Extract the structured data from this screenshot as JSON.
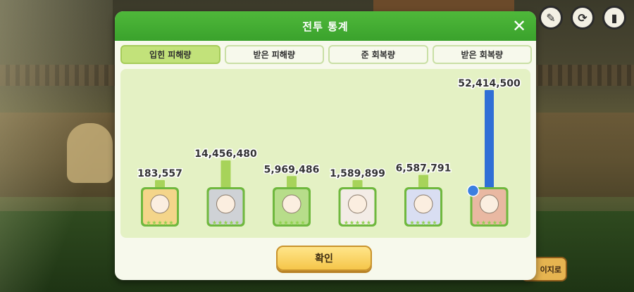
{
  "modal": {
    "title": "전투 통계",
    "close_label": "✕"
  },
  "tabs": [
    {
      "label": "입힌 피해량",
      "active": true
    },
    {
      "label": "받은 피해량",
      "active": false
    },
    {
      "label": "준 회복량",
      "active": false
    },
    {
      "label": "받은 회복량",
      "active": false
    }
  ],
  "confirm_label": "확인",
  "side_tab_label": "이지로",
  "hud": {
    "icons": [
      "pin-icon",
      "swap-icon",
      "stats-icon"
    ]
  },
  "colors": {
    "header_green": "#3aa22c",
    "bar_green": "#a7d35a",
    "bar_blue": "#2f6fd6",
    "panel_bg": "#e4f1c4"
  },
  "chart_data": {
    "type": "bar",
    "title": "",
    "xlabel": "",
    "ylabel": "",
    "categories": [
      "character-1",
      "character-2",
      "character-3",
      "character-4",
      "character-5",
      "character-6"
    ],
    "value_labels": [
      "183,557",
      "14,456,480",
      "5,969,486",
      "1,589,899",
      "6,587,791",
      "52,414,500"
    ],
    "values": [
      183557,
      14456480,
      5969486,
      1589899,
      6587791,
      52414500
    ],
    "highlight_index": 5,
    "ylim": [
      0,
      52414500
    ]
  }
}
